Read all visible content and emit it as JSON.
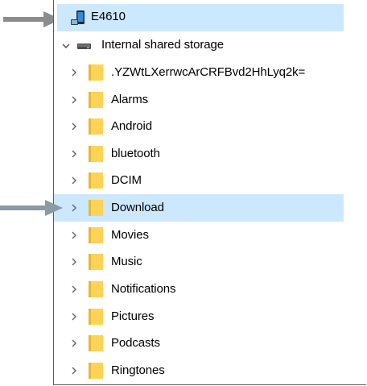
{
  "tree": {
    "device": {
      "label": "E4610",
      "icon": "phone-device-icon"
    },
    "storage": {
      "label": "Internal shared storage",
      "icon": "drive-icon"
    },
    "folders": [
      {
        "label": ".YZWtLXerrwcArCRFBvd2HhLyq2k="
      },
      {
        "label": "Alarms"
      },
      {
        "label": "Android"
      },
      {
        "label": "bluetooth"
      },
      {
        "label": "DCIM"
      },
      {
        "label": "Download",
        "selected": true
      },
      {
        "label": "Movies"
      },
      {
        "label": "Music"
      },
      {
        "label": "Notifications"
      },
      {
        "label": "Pictures"
      },
      {
        "label": "Podcasts"
      },
      {
        "label": "Ringtones"
      }
    ]
  },
  "colors": {
    "selection": "#cce8ff",
    "folder": "#ffd258",
    "folder_shadow": "#e8b730",
    "pointer_arrow": "#8c8c8c",
    "pointer_arrow_selected": "#8a9aa6"
  }
}
